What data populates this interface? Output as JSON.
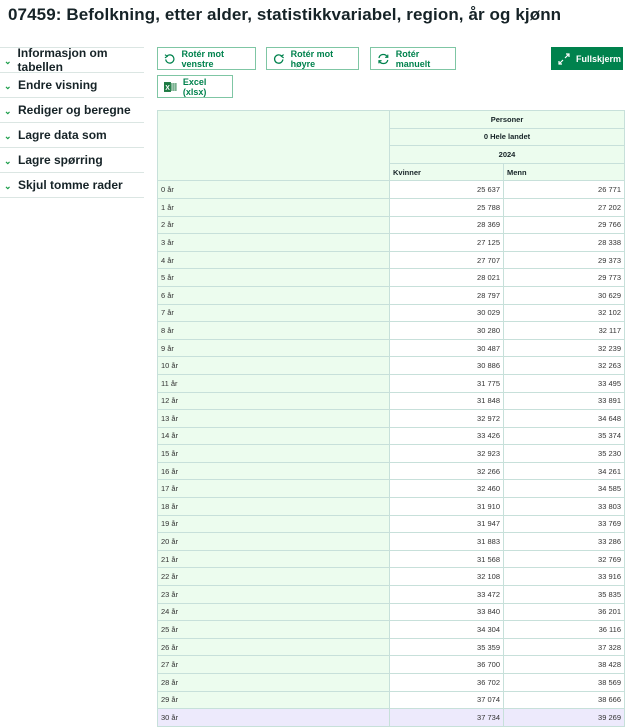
{
  "title": "07459: Befolkning, etter alder, statistikkvariabel, region, år og kjønn",
  "sidebar": {
    "items": [
      {
        "label": "Informasjon om tabellen"
      },
      {
        "label": "Endre visning"
      },
      {
        "label": "Rediger og beregne"
      },
      {
        "label": "Lagre data som"
      },
      {
        "label": "Lagre spørring"
      },
      {
        "label": "Skjul tomme rader"
      }
    ]
  },
  "toolbar": {
    "rotate_left": "Rotér mot venstre",
    "rotate_right": "Rotér mot høyre",
    "rotate_manual": "Rotér manuelt",
    "fullscreen": "Fullskjerm",
    "excel": "Excel (xlsx)"
  },
  "colors": {
    "accent": "#00824d",
    "header_bg": "#ecfcee",
    "highlight": "#edeafc"
  },
  "table": {
    "statistic": "Personer",
    "region": "0 Hele landet",
    "year": "2024",
    "columns": [
      "Kvinner",
      "Menn"
    ],
    "rows": [
      [
        "0 år",
        "25 637",
        "26 771"
      ],
      [
        "1 år",
        "25 788",
        "27 202"
      ],
      [
        "2 år",
        "28 369",
        "29 766"
      ],
      [
        "3 år",
        "27 125",
        "28 338"
      ],
      [
        "4 år",
        "27 707",
        "29 373"
      ],
      [
        "5 år",
        "28 021",
        "29 773"
      ],
      [
        "6 år",
        "28 797",
        "30 629"
      ],
      [
        "7 år",
        "30 029",
        "32 102"
      ],
      [
        "8 år",
        "30 280",
        "32 117"
      ],
      [
        "9 år",
        "30 487",
        "32 239"
      ],
      [
        "10 år",
        "30 886",
        "32 263"
      ],
      [
        "11 år",
        "31 775",
        "33 495"
      ],
      [
        "12 år",
        "31 848",
        "33 891"
      ],
      [
        "13 år",
        "32 972",
        "34 648"
      ],
      [
        "14 år",
        "33 426",
        "35 374"
      ],
      [
        "15 år",
        "32 923",
        "35 230"
      ],
      [
        "16 år",
        "32 266",
        "34 261"
      ],
      [
        "17 år",
        "32 460",
        "34 585"
      ],
      [
        "18 år",
        "31 910",
        "33 803"
      ],
      [
        "19 år",
        "31 947",
        "33 769"
      ],
      [
        "20 år",
        "31 883",
        "33 286"
      ],
      [
        "21 år",
        "31 568",
        "32 769"
      ],
      [
        "22 år",
        "32 108",
        "33 916"
      ],
      [
        "23 år",
        "33 472",
        "35 835"
      ],
      [
        "24 år",
        "33 840",
        "36 201"
      ],
      [
        "25 år",
        "34 304",
        "36 116"
      ],
      [
        "26 år",
        "35 359",
        "37 328"
      ],
      [
        "27 år",
        "36 700",
        "38 428"
      ],
      [
        "28 år",
        "36 702",
        "38 569"
      ],
      [
        "29 år",
        "37 074",
        "38 666"
      ],
      [
        "30 år",
        "37 734",
        "39 269"
      ]
    ]
  }
}
